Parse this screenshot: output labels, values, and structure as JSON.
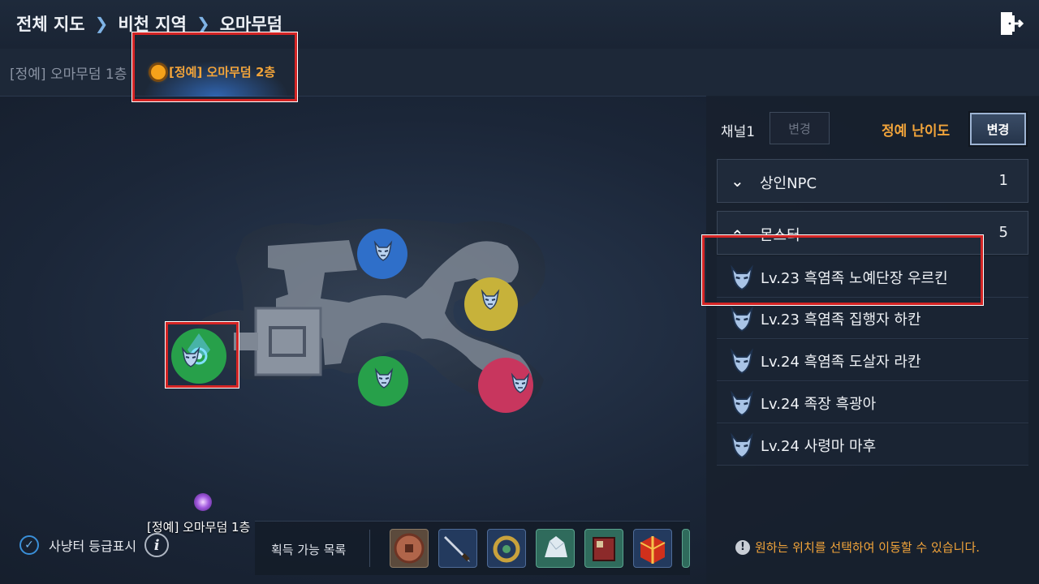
{
  "breadcrumb": {
    "items": [
      "전체 지도",
      "비천 지역",
      "오마무덤"
    ]
  },
  "floors": {
    "floor1_label": "[정예] 오마무덤 1층",
    "floor2_label": "[정예] 오마무덤 2층"
  },
  "map": {
    "portal_label": "[정예] 오마무덤 1층"
  },
  "sidebar": {
    "channel_label": "채널1",
    "channel_change": "변경",
    "difficulty_label": "정예 난이도",
    "difficulty_change": "변경",
    "sections": {
      "npc": {
        "label": "상인NPC",
        "count": "1"
      },
      "monster": {
        "label": "몬스터",
        "count": "5"
      }
    },
    "monsters": [
      "Lv.23 흑염족 노예단장 우르킨",
      "Lv.23 흑염족 집행자 하칸",
      "Lv.24 흑염족 도살자 라칸",
      "Lv.24 족장 흑광아",
      "Lv.24 사령마 마후"
    ]
  },
  "bottom": {
    "grade_display_label": "사냥터 등급표시",
    "loot_label": "획득 가능 목록",
    "notice": "원하는 위치를 선택하여 이동할 수 있습니다."
  },
  "colors": {
    "accent_orange": "#f2a43a",
    "highlight_red": "#d42424"
  },
  "icons": [
    "exit-icon",
    "chevron-right-icon",
    "monster-mask-icon",
    "portal-icon",
    "check-icon",
    "info-icon",
    "exclamation-icon"
  ]
}
